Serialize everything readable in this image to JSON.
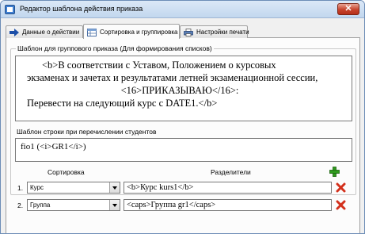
{
  "window": {
    "title": "Редактор шаблона действия приказа",
    "close_label": "✕"
  },
  "tabs": [
    {
      "label": "Данные о действии",
      "icon": "arrow-right-icon"
    },
    {
      "label": "Сортировка и группировка",
      "icon": "table-icon"
    },
    {
      "label": "Настройки печати",
      "icon": "printer-icon"
    }
  ],
  "group": {
    "legend": "Шаблон для группового приказа (Для формирования списков)",
    "template_lines": [
      "<b>В соответствии с Уставом,  Положением о курсовых",
      "экзаменах и зачетах и результатами летней экзаменационной сессии,",
      "<16>ПРИКАЗЫВАЮ</16>:",
      "Перевести на следующий курс с DATE1.</b>"
    ],
    "row_label": "Шаблон строки при перечислении студентов",
    "row_template": "fio1 (<i>GR1</i>)"
  },
  "sorting": {
    "col_sort": "Сортировка",
    "col_separators": "Разделители",
    "rows": [
      {
        "num": "1.",
        "field": "Курс",
        "separator": "<b>Курс kurs1</b>"
      },
      {
        "num": "2.",
        "field": "Группа",
        "separator": "<caps>Группа gr1</caps>"
      }
    ]
  },
  "colors": {
    "add": "#2f9a1e",
    "delete": "#d3301c"
  }
}
